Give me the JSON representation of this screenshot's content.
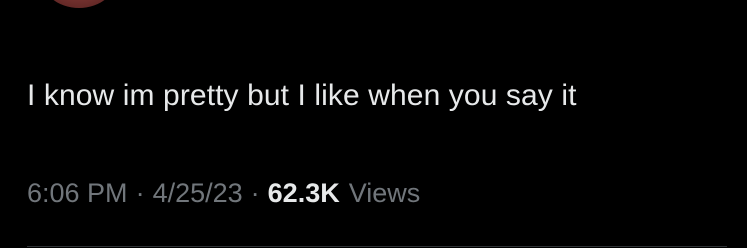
{
  "tweet": {
    "text": "I know im pretty but I like when you say it",
    "time": "6:06 PM",
    "separator": "·",
    "date": "4/25/23",
    "views_count": "62.3K",
    "views_label": "Views"
  }
}
